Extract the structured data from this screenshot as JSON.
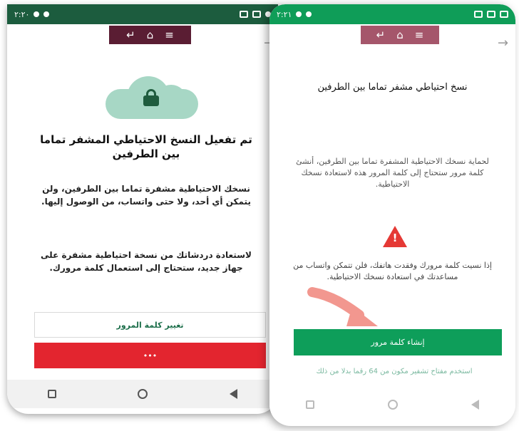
{
  "left_screen": {
    "status_time": "۲:۲۰",
    "title": "تم تفعيل النسخ الاحتياطي المشفر تماما بين الطرفين",
    "paragraph1": "نسخك الاحتياطية مشفرة تماما بين الطرفين، ولن يتمكن أي أحد، ولا حتى واتساب، من الوصول إليها.",
    "paragraph2": "لاستعادة دردشاتك من نسخة احتياطية مشفرة على جهاز جديد، ستحتاج إلى استعمال كلمة مرورك.",
    "change_password_button": "تغيير كلمة المرور",
    "red_button": "•••"
  },
  "right_screen": {
    "status_time": "۲:۲۱",
    "title": "نسخ احتياطي مشفر تماما بين الطرفين",
    "paragraph1": "لحماية نسخك الاحتياطية المشفرة تماما بين الطرفين، أنشئ كلمة مرور ستحتاج إلى كلمة المرور هذه لاستعادة نسخك الاحتياطية.",
    "warning_text": "إذا نسيت كلمة مرورك وفقدت هاتفك، فلن تتمكن واتساب من مساعدتك في استعادة نسخك الاحتياطية.",
    "create_password_button": "إنشاء كلمة مرور",
    "alt_link": "استخدم مفتاح تشفير مكون من 64 رقما بدلا من ذلك"
  },
  "colors": {
    "whatsapp_green": "#0e9e5a",
    "danger_red": "#e3252f",
    "cloud": "#a7d7c5"
  }
}
